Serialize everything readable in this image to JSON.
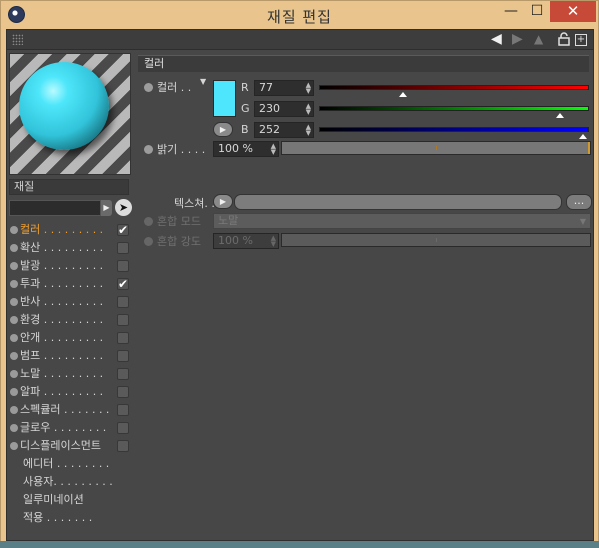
{
  "window": {
    "title": "재질 편집",
    "minimize": "—",
    "maximize": "☐",
    "close": "✕"
  },
  "toolbar": {
    "back_icon": "◀",
    "forward_icon": "◀",
    "up_icon": "▲",
    "lock_icon": "🔓",
    "newwin_icon": "+"
  },
  "material": {
    "name": "재질",
    "preview_color": "#4de6fc"
  },
  "channels": [
    {
      "label": "컬러 . . . . . . . . .",
      "checked": true,
      "active": true,
      "has_dot": true
    },
    {
      "label": "확산 . . . . . . . . .",
      "checked": false,
      "active": false,
      "has_dot": true
    },
    {
      "label": "발광 . . . . . . . . .",
      "checked": false,
      "active": false,
      "has_dot": true
    },
    {
      "label": "투과 . . . . . . . . .",
      "checked": true,
      "active": false,
      "has_dot": true
    },
    {
      "label": "반사 . . . . . . . . .",
      "checked": false,
      "active": false,
      "has_dot": true
    },
    {
      "label": "환경 . . . . . . . . .",
      "checked": false,
      "active": false,
      "has_dot": true
    },
    {
      "label": "안개 . . . . . . . . .",
      "checked": false,
      "active": false,
      "has_dot": true
    },
    {
      "label": "범프 . . . . . . . . .",
      "checked": false,
      "active": false,
      "has_dot": true
    },
    {
      "label": "노말 . . . . . . . . .",
      "checked": false,
      "active": false,
      "has_dot": true
    },
    {
      "label": "알파 . . . . . . . . .",
      "checked": false,
      "active": false,
      "has_dot": true
    },
    {
      "label": "스펙큘러 . . . . . . .",
      "checked": false,
      "active": false,
      "has_dot": true
    },
    {
      "label": "글로우 . . . . . . . .",
      "checked": false,
      "active": false,
      "has_dot": true
    },
    {
      "label": "디스플레이스먼트",
      "checked": false,
      "active": false,
      "has_dot": true
    }
  ],
  "sub_items": [
    {
      "label": "에디터 . . . . . . . ."
    },
    {
      "label": "사용자. . . . . . . . ."
    },
    {
      "label": "일루미네이션"
    },
    {
      "label": "적용 . . . . . . ."
    }
  ],
  "color_section": {
    "header": "컬러",
    "color_label": "컬러 . .",
    "swatch": "#4de6fc",
    "r_label": "R",
    "g_label": "G",
    "b_label": "B",
    "r_value": "77",
    "g_value": "230",
    "b_value": "252",
    "r": 77,
    "g": 230,
    "b": 252,
    "brightness_label": "밝기 . . . .",
    "brightness_value": "100 %",
    "brightness": 100,
    "texture_label": "텍스쳐. . . .",
    "texture_button": "...",
    "blend_mode_label": "혼합 모드",
    "blend_mode_value": "노말",
    "blend_strength_label": "혼합 강도",
    "blend_strength_value": "100 %"
  }
}
